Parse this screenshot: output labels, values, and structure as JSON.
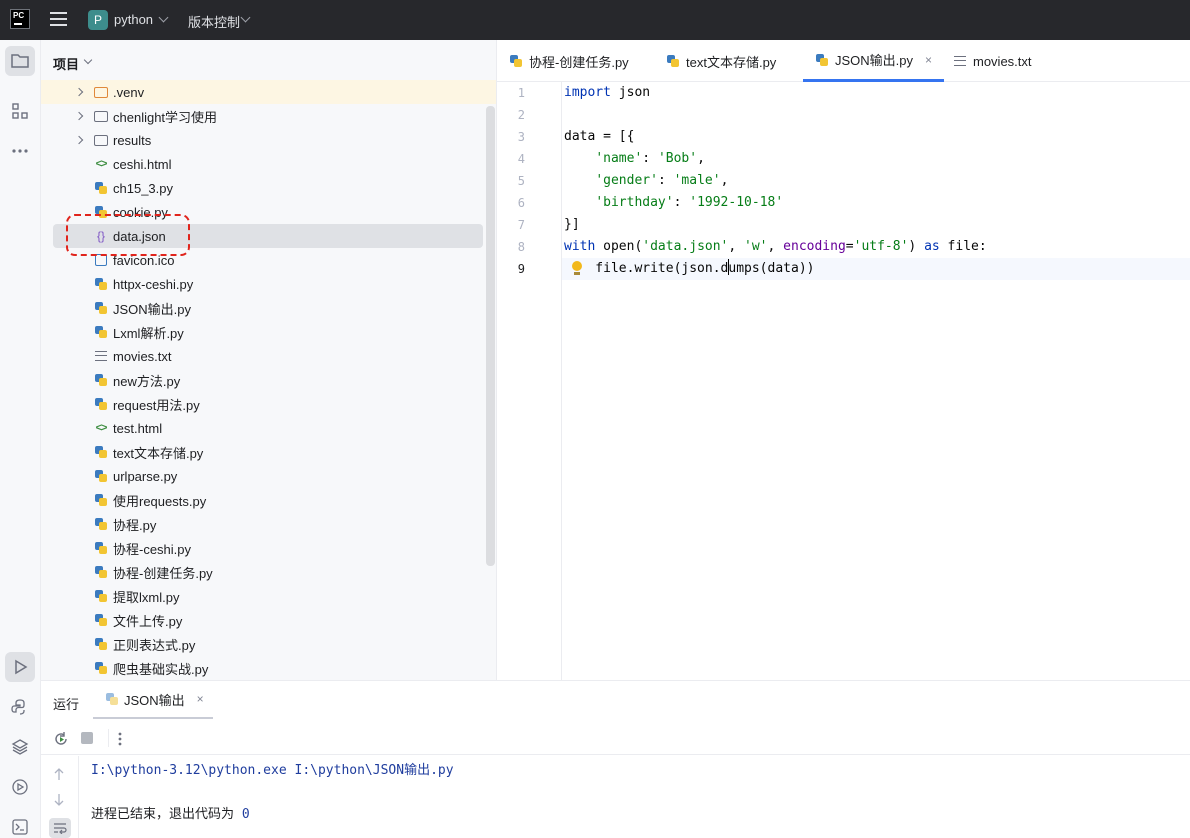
{
  "titlebar": {
    "logo_text": "PC",
    "project_badge": "P",
    "project_name": "python",
    "vcs_label": "版本控制"
  },
  "project_panel": {
    "header": "项目",
    "items": [
      {
        "type": "folder",
        "name": ".venv",
        "icon": "folder-orange-icon",
        "expandable": true,
        "highlighted": true
      },
      {
        "type": "folder",
        "name": "chenlight学习使用",
        "icon": "folder-icon",
        "expandable": true
      },
      {
        "type": "folder",
        "name": "results",
        "icon": "folder-icon",
        "expandable": true
      },
      {
        "type": "html",
        "name": "ceshi.html",
        "icon": "html-icon"
      },
      {
        "type": "py",
        "name": "ch15_3.py",
        "icon": "python-icon"
      },
      {
        "type": "py",
        "name": "cookie.py",
        "icon": "python-icon"
      },
      {
        "type": "json",
        "name": "data.json",
        "icon": "json-icon",
        "selected": true
      },
      {
        "type": "ico",
        "name": "favicon.ico",
        "icon": "image-icon"
      },
      {
        "type": "py",
        "name": "httpx-ceshi.py",
        "icon": "python-icon"
      },
      {
        "type": "py",
        "name": "JSON输出.py",
        "icon": "python-icon"
      },
      {
        "type": "py",
        "name": "Lxml解析.py",
        "icon": "python-icon"
      },
      {
        "type": "txt",
        "name": "movies.txt",
        "icon": "text-file-icon"
      },
      {
        "type": "py",
        "name": "new方法.py",
        "icon": "python-icon"
      },
      {
        "type": "py",
        "name": "request用法.py",
        "icon": "python-icon"
      },
      {
        "type": "html",
        "name": "test.html",
        "icon": "html-icon"
      },
      {
        "type": "py",
        "name": "text文本存储.py",
        "icon": "python-icon"
      },
      {
        "type": "py",
        "name": "urlparse.py",
        "icon": "python-icon"
      },
      {
        "type": "py",
        "name": "使用requests.py",
        "icon": "python-icon"
      },
      {
        "type": "py",
        "name": "协程.py",
        "icon": "python-icon"
      },
      {
        "type": "py",
        "name": "协程-ceshi.py",
        "icon": "python-icon"
      },
      {
        "type": "py",
        "name": "协程-创建任务.py",
        "icon": "python-icon"
      },
      {
        "type": "py",
        "name": "提取lxml.py",
        "icon": "python-icon"
      },
      {
        "type": "py",
        "name": "文件上传.py",
        "icon": "python-icon"
      },
      {
        "type": "py",
        "name": "正则表达式.py",
        "icon": "python-icon"
      },
      {
        "type": "py",
        "name": "爬虫基础实战.py",
        "icon": "python-icon"
      }
    ]
  },
  "editor": {
    "tabs": [
      {
        "label": "协程-创建任务.py",
        "icon": "python-icon",
        "active": false
      },
      {
        "label": "text文本存储.py",
        "icon": "python-icon",
        "active": false
      },
      {
        "label": "JSON输出.py",
        "icon": "python-icon",
        "active": true,
        "close": "×"
      },
      {
        "label": "movies.txt",
        "icon": "text-file-icon",
        "active": false
      }
    ],
    "line_numbers": [
      "1",
      "2",
      "3",
      "4",
      "5",
      "6",
      "7",
      "8",
      "9"
    ],
    "current_line": "9",
    "code": {
      "l1_kw": "import",
      "l1_rest": " json",
      "l3": "data = [{",
      "l4_ind": "    ",
      "l4_key": "'name'",
      "l4_sep": ": ",
      "l4_val": "'Bob'",
      "l4_end": ",",
      "l5_ind": "    ",
      "l5_key": "'gender'",
      "l5_sep": ": ",
      "l5_val": "'male'",
      "l5_end": ",",
      "l6_ind": "    ",
      "l6_key": "'birthday'",
      "l6_sep": ": ",
      "l6_val": "'1992-10-18'",
      "l7": "}]",
      "l8_kw1": "with",
      "l8_a": " open(",
      "l8_s1": "'data.json'",
      "l8_b": ", ",
      "l8_s2": "'w'",
      "l8_c": ", ",
      "l8_kwarg": "encoding",
      "l8_d": "=",
      "l8_s3": "'utf-8'",
      "l8_e": ") ",
      "l8_kw2": "as",
      "l8_f": " file:",
      "l9_a": "    file.write(json.d",
      "l9_b": "umps(data))"
    }
  },
  "run_panel": {
    "title": "运行",
    "tab_label": "JSON输出",
    "tab_close": "×",
    "output_line1": "I:\\python-3.12\\python.exe I:\\python\\JSON输出.py",
    "output_line2_text": "进程已结束，退出代码为 ",
    "output_line2_code": "0"
  },
  "colors": {
    "titlebar_bg": "#27282c",
    "accent": "#3574f0",
    "keyword": "#0033b3",
    "string": "#067d17",
    "selection_annotation": "#e0241c"
  }
}
